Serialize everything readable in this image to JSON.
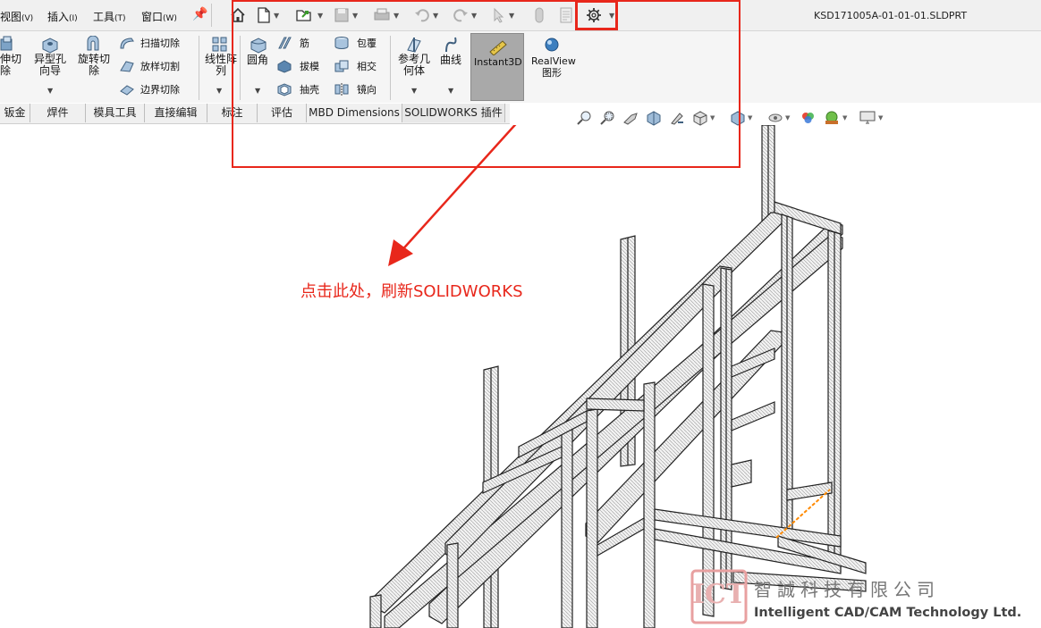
{
  "menubar": {
    "items": [
      {
        "label": "视图",
        "accel": "(V)"
      },
      {
        "label": "插入",
        "accel": "(I)"
      },
      {
        "label": "工具",
        "accel": "(T)"
      },
      {
        "label": "窗口",
        "accel": "(W)"
      }
    ],
    "document_title": "KSD171005A-01-01-01.SLDPRT"
  },
  "ribbon": {
    "col1": {
      "l1": "伸切",
      "l2": "除"
    },
    "hole_wizard": {
      "l1": "异型孔",
      "l2": "向导"
    },
    "revolve_cut": {
      "l1": "旋转切",
      "l2": "除"
    },
    "sweep_cut": "扫描切除",
    "loft_cut": "放样切割",
    "boundary_cut": "边界切除",
    "linear_pattern": {
      "l1": "线性阵",
      "l2": "列"
    },
    "fillet": "圆角",
    "rib": "筋",
    "draft": "拔模",
    "shell": "抽壳",
    "wrap": "包覆",
    "intersect": "相交",
    "mirror": "镜向",
    "ref_geometry": {
      "l1": "参考几",
      "l2": "何体"
    },
    "curves": "曲线",
    "instant3d": "Instant3D",
    "realview": {
      "l1": "RealView",
      "l2": "图形"
    }
  },
  "tabs": [
    "钣金",
    "焊件",
    "模具工具",
    "直接编辑",
    "标注",
    "评估",
    "MBD Dimensions",
    "SOLIDWORKS 插件"
  ],
  "annotation": {
    "text": "点击此处，刷新SOLIDWORKS",
    "color": "#e8271b"
  },
  "watermark": {
    "mark": "ICT",
    "name_zh": "智誠科技有限公司",
    "name_en": "Intelligent CAD/CAM Technology Ltd."
  },
  "icons": [
    "home-icon",
    "new-document-icon",
    "open-icon",
    "save-icon",
    "print-icon",
    "undo-icon",
    "redo-icon",
    "select-icon",
    "rebuild-icon",
    "file-properties-icon",
    "options-gear-icon"
  ]
}
